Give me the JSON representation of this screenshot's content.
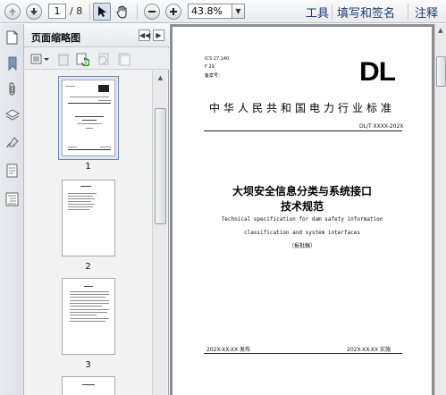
{
  "toolbar": {
    "current_page": "1",
    "total_pages": "/ 8",
    "zoom": "43.8%",
    "links": [
      "工具",
      "填写和签名",
      "注释"
    ]
  },
  "panel": {
    "title": "页面缩略图",
    "thumbnails": [
      {
        "number": "1"
      },
      {
        "number": "2"
      },
      {
        "number": "3"
      }
    ]
  },
  "document": {
    "ics": "ICS 27.140",
    "class_code": "F 29",
    "record_no": "备案号：",
    "logo": "DL",
    "standard_title": "中华人民共和国电力行业标准",
    "standard_number": "DL/T XXXX-202X",
    "main_title_line1": "大坝安全信息分类与系统接口",
    "main_title_line2": "技术规范",
    "en_title_line1": "Technical specification for dam safety information",
    "en_title_line2": "classification and system interfaces",
    "draft_note": "（报批稿）",
    "publish_date": "202X-XX-XX  发布",
    "implement_date": "202X-XX-XX  实施"
  },
  "colors": {
    "link": "#1a3a73",
    "doc_background": "#8a8d92",
    "panel_background": "#f2f2f2"
  }
}
